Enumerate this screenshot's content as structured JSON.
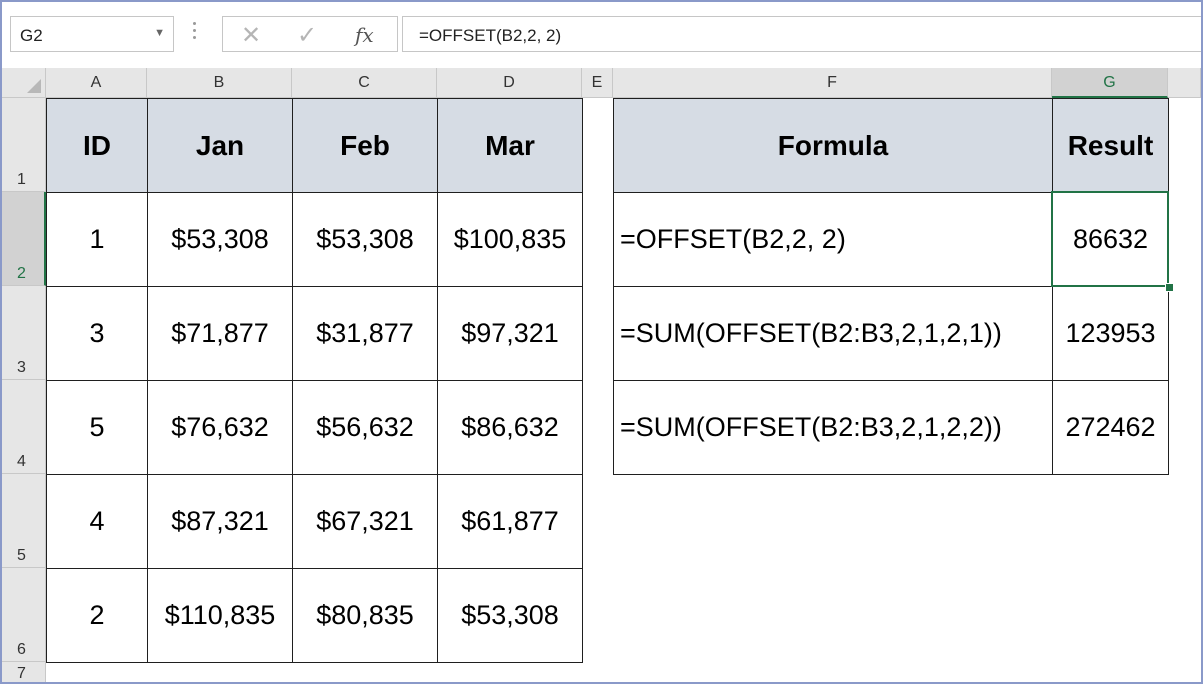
{
  "formula_bar": {
    "name_box": "G2",
    "formula": "=OFFSET(B2,2, 2)",
    "icons": [
      "cancel-icon",
      "enter-icon",
      "function-icon"
    ],
    "fx_label": "fx"
  },
  "columns": [
    "A",
    "B",
    "C",
    "D",
    "E",
    "F",
    "G"
  ],
  "rows": [
    "1",
    "2",
    "3",
    "4",
    "5",
    "6",
    "7"
  ],
  "table": {
    "headers": [
      "ID",
      "Jan",
      "Feb",
      "Mar"
    ],
    "rows": [
      [
        "1",
        "$53,308",
        "$53,308",
        "$100,835"
      ],
      [
        "3",
        "$71,877",
        "$31,877",
        "$97,321"
      ],
      [
        "5",
        "$76,632",
        "$56,632",
        "$86,632"
      ],
      [
        "4",
        "$87,321",
        "$67,321",
        "$61,877"
      ],
      [
        "2",
        "$110,835",
        "$80,835",
        "$53,308"
      ]
    ]
  },
  "formula_table": {
    "headers": [
      "Formula",
      "Result"
    ],
    "rows": [
      [
        "=OFFSET(B2,2, 2)",
        "86632"
      ],
      [
        "=SUM(OFFSET(B2:B3,2,1,2,1))",
        "123953"
      ],
      [
        "=SUM(OFFSET(B2:B3,2,1,2,2))",
        "272462"
      ]
    ]
  },
  "colors": {
    "header_fill": "#d6dce4",
    "selection": "#217346"
  }
}
